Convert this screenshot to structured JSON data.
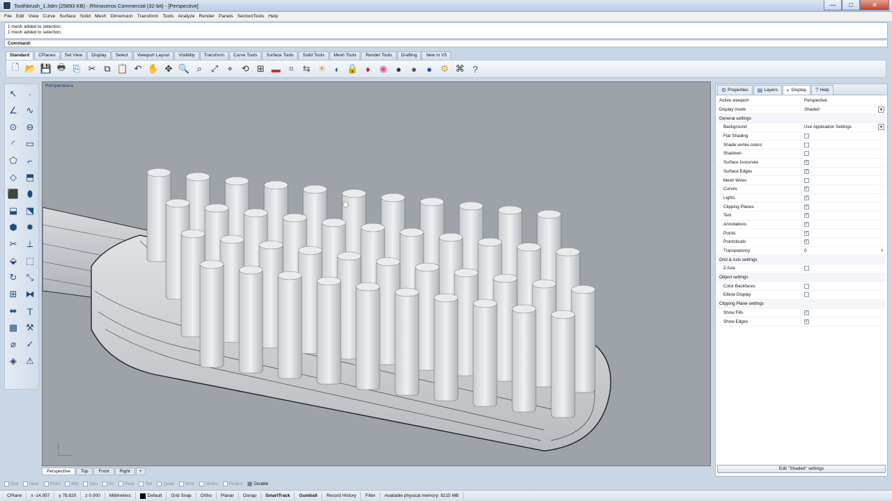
{
  "window": {
    "title": "Toothbrush_1.3dm (25893 KB) - Rhinoceros Commercial (32-bit) - [Perspective]",
    "minimize": "—",
    "maximize": "□",
    "close": "✕"
  },
  "menu": [
    "File",
    "Edit",
    "View",
    "Curve",
    "Surface",
    "Solid",
    "Mesh",
    "Dimension",
    "Transform",
    "Tools",
    "Analyze",
    "Render",
    "Panels",
    "SectionTools",
    "Help"
  ],
  "history": [
    "1 mesh added to selection.",
    "1 mesh added to selection."
  ],
  "command": {
    "label": "Command:",
    "value": ""
  },
  "toolbar_tabs": [
    "Standard",
    "CPlanes",
    "Set View",
    "Display",
    "Select",
    "Viewport Layout",
    "Visibility",
    "Transform",
    "Curve Tools",
    "Surface Tools",
    "Solid Tools",
    "Mesh Tools",
    "Render Tools",
    "Drafting",
    "New in V5"
  ],
  "toolbar_icons": [
    {
      "name": "new-icon",
      "glyph": "🗋",
      "color": "#3a6ea5"
    },
    {
      "name": "open-icon",
      "glyph": "📂",
      "color": "#d9a21b"
    },
    {
      "name": "save-icon",
      "glyph": "💾",
      "color": "#2f4f7f"
    },
    {
      "name": "print-icon",
      "glyph": "🖶",
      "color": "#444"
    },
    {
      "name": "import-icon",
      "glyph": "⎘",
      "color": "#3a6ea5"
    },
    {
      "name": "cut-icon",
      "glyph": "✂",
      "color": "#333"
    },
    {
      "name": "copy-icon",
      "glyph": "⧉",
      "color": "#333"
    },
    {
      "name": "paste-icon",
      "glyph": "📋",
      "color": "#c9a230"
    },
    {
      "name": "undo-icon",
      "glyph": "↶",
      "color": "#333"
    },
    {
      "name": "pan-icon",
      "glyph": "✋",
      "color": "#555"
    },
    {
      "name": "move-icon",
      "glyph": "✥",
      "color": "#333"
    },
    {
      "name": "zoom-icon",
      "glyph": "🔍",
      "color": "#333"
    },
    {
      "name": "zoom-window-icon",
      "glyph": "⌕",
      "color": "#333"
    },
    {
      "name": "zoom-extents-icon",
      "glyph": "⤢",
      "color": "#333"
    },
    {
      "name": "zoom-selected-icon",
      "glyph": "⌖",
      "color": "#333"
    },
    {
      "name": "rotate-view-icon",
      "glyph": "⟲",
      "color": "#333"
    },
    {
      "name": "viewport-layout-icon",
      "glyph": "⊞",
      "color": "#333"
    },
    {
      "name": "cplane-icon",
      "glyph": "▬",
      "color": "#c23030"
    },
    {
      "name": "grid-icon",
      "glyph": "⌗",
      "color": "#555"
    },
    {
      "name": "history-icon",
      "glyph": "⇆",
      "color": "#555"
    },
    {
      "name": "light-icon",
      "glyph": "☀",
      "color": "#c9a230"
    },
    {
      "name": "properties-icon",
      "glyph": "◐",
      "color": "#2a5d9c"
    },
    {
      "name": "lock-icon",
      "glyph": "🔒",
      "color": "#888"
    },
    {
      "name": "render-icon",
      "glyph": "♦",
      "color": "#b3302c"
    },
    {
      "name": "color-wheel-icon",
      "glyph": "◉",
      "color": "#d94f8a"
    },
    {
      "name": "material-icon",
      "glyph": "●",
      "color": "#333"
    },
    {
      "name": "render-preview-icon",
      "glyph": "●",
      "color": "#555"
    },
    {
      "name": "rendered-sphere-icon",
      "glyph": "●",
      "color": "#1f4fa3"
    },
    {
      "name": "options-icon",
      "glyph": "⚙",
      "color": "#c9a230"
    },
    {
      "name": "snapshot-icon",
      "glyph": "⌘",
      "color": "#333"
    },
    {
      "name": "help-icon",
      "glyph": "?",
      "color": "#1f4fa3"
    }
  ],
  "sidebar_icons": [
    {
      "name": "select-arrow-icon",
      "glyph": "↖"
    },
    {
      "name": "point-icon",
      "glyph": "·"
    },
    {
      "name": "polyline-icon",
      "glyph": "∠"
    },
    {
      "name": "curve-icon",
      "glyph": "∿"
    },
    {
      "name": "circle-icon",
      "glyph": "⊙"
    },
    {
      "name": "ellipse-icon",
      "glyph": "⊖"
    },
    {
      "name": "arc-icon",
      "glyph": "◜"
    },
    {
      "name": "rectangle-icon",
      "glyph": "▭"
    },
    {
      "name": "polygon-icon",
      "glyph": "⬠"
    },
    {
      "name": "fillet-icon",
      "glyph": "⌐"
    },
    {
      "name": "surface-icon",
      "glyph": "◇"
    },
    {
      "name": "loft-icon",
      "glyph": "⬒"
    },
    {
      "name": "box-icon",
      "glyph": "⬛"
    },
    {
      "name": "sphere-solid-icon",
      "glyph": "⬮"
    },
    {
      "name": "extrude-icon",
      "glyph": "⬓"
    },
    {
      "name": "boolean-icon",
      "glyph": "⬔"
    },
    {
      "name": "mesh-icon",
      "glyph": "⬢"
    },
    {
      "name": "explode-icon",
      "glyph": "✸"
    },
    {
      "name": "trim-icon",
      "glyph": "✂"
    },
    {
      "name": "split-icon",
      "glyph": "⟂"
    },
    {
      "name": "group-icon",
      "glyph": "⬙"
    },
    {
      "name": "block-icon",
      "glyph": "⬚"
    },
    {
      "name": "rotate-icon",
      "glyph": "↻"
    },
    {
      "name": "scale-icon",
      "glyph": "⤡"
    },
    {
      "name": "array-icon",
      "glyph": "⊞"
    },
    {
      "name": "mirror-icon",
      "glyph": "⧓"
    },
    {
      "name": "dimension-icon",
      "glyph": "⬌"
    },
    {
      "name": "text-icon",
      "glyph": "Ｔ"
    },
    {
      "name": "grid-array-icon",
      "glyph": "▦"
    },
    {
      "name": "wrench-icon",
      "glyph": "⚒"
    },
    {
      "name": "analyze-icon",
      "glyph": "⌀"
    },
    {
      "name": "check-icon",
      "glyph": "✓"
    },
    {
      "name": "render-mesh-icon",
      "glyph": "◈"
    },
    {
      "name": "warning-icon",
      "glyph": "⚠"
    }
  ],
  "viewport": {
    "label": "Perspective",
    "caret": "▸"
  },
  "viewport_tabs": [
    "Perspective",
    "Top",
    "Front",
    "Right",
    "+"
  ],
  "osnaps": [
    {
      "label": "End",
      "on": false
    },
    {
      "label": "Near",
      "on": false
    },
    {
      "label": "Point",
      "on": false
    },
    {
      "label": "Mid",
      "on": false
    },
    {
      "label": "Cen",
      "on": false
    },
    {
      "label": "Int",
      "on": false
    },
    {
      "label": "Perp",
      "on": false
    },
    {
      "label": "Tan",
      "on": false
    },
    {
      "label": "Quad",
      "on": false
    },
    {
      "label": "Knot",
      "on": false
    },
    {
      "label": "Vertex",
      "on": false
    },
    {
      "label": "Project",
      "on": false
    },
    {
      "label": "Disable",
      "on": true
    }
  ],
  "status": {
    "cplane": "CPlane",
    "x": "x -14.957",
    "y": "y 78.820",
    "z": "z 0.000",
    "units": "Millimeters",
    "layer": "Default",
    "grid_snap": "Grid Snap",
    "ortho": "Ortho",
    "planar": "Planar",
    "osnap": "Osnap",
    "smarttrack": "SmartTrack",
    "gumball": "Gumball",
    "record_history": "Record History",
    "filter": "Filter",
    "memory": "Available physical memory: 8215 MB"
  },
  "panel": {
    "tabs": [
      {
        "label": "Properties",
        "icon": "⚙"
      },
      {
        "label": "Layers",
        "icon": "▤"
      },
      {
        "label": "Display",
        "icon": "◐"
      },
      {
        "label": "Help",
        "icon": "?"
      }
    ],
    "rows": [
      {
        "k": "Active viewport",
        "v": "Perspective",
        "type": "text"
      },
      {
        "k": "Display mode",
        "v": "Shaded",
        "type": "dropdown"
      },
      {
        "k": "General settings",
        "type": "section"
      },
      {
        "k": "Background",
        "v": "Use Application Settings",
        "type": "dropdown",
        "indent": true
      },
      {
        "k": "Flat Shading",
        "checked": false,
        "type": "check",
        "indent": true
      },
      {
        "k": "Shade vertex colors",
        "checked": false,
        "type": "check",
        "indent": true
      },
      {
        "k": "Shadows",
        "checked": false,
        "type": "check",
        "indent": true
      },
      {
        "k": "Surface Isocurves",
        "checked": true,
        "type": "check",
        "indent": true
      },
      {
        "k": "Surface Edges",
        "checked": true,
        "type": "check",
        "indent": true
      },
      {
        "k": "Mesh Wires",
        "checked": false,
        "type": "check",
        "indent": true
      },
      {
        "k": "Curves",
        "checked": true,
        "type": "check",
        "indent": true
      },
      {
        "k": "Lights",
        "checked": true,
        "type": "check",
        "indent": true
      },
      {
        "k": "Clipping Planes",
        "checked": true,
        "type": "check",
        "indent": true
      },
      {
        "k": "Text",
        "checked": true,
        "type": "check",
        "indent": true
      },
      {
        "k": "Annotations",
        "checked": true,
        "type": "check",
        "indent": true
      },
      {
        "k": "Points",
        "checked": true,
        "type": "check",
        "indent": true
      },
      {
        "k": "Pointclouds",
        "checked": true,
        "type": "check",
        "indent": true
      },
      {
        "k": "Transparency",
        "v": "0",
        "type": "spin",
        "indent": true
      },
      {
        "k": "Grid & Axis settings",
        "type": "section"
      },
      {
        "k": "Z Axis",
        "checked": false,
        "type": "check",
        "indent": true
      },
      {
        "k": "Object settings",
        "type": "section"
      },
      {
        "k": "Color Backfaces",
        "checked": false,
        "type": "check",
        "indent": true
      },
      {
        "k": "Elbow Display",
        "checked": false,
        "type": "check",
        "indent": true
      },
      {
        "k": "Clipping Plane settings",
        "type": "section"
      },
      {
        "k": "Show Fills",
        "checked": true,
        "type": "check",
        "indent": true
      },
      {
        "k": "Show Edges",
        "checked": true,
        "type": "check",
        "indent": true
      }
    ],
    "edit_button": "Edit \"Shaded\" settings"
  }
}
